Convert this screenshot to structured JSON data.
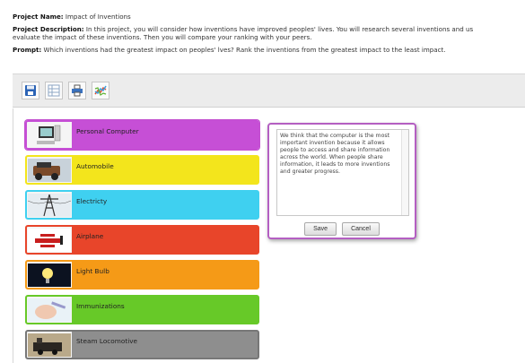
{
  "project": {
    "name_label": "Project Name:",
    "name_value": "Impact of Inventions",
    "description_label": "Project Description:",
    "description_line1": "In this project, you will consider how inventions have improved peoples' lives. You will research several inventions and us",
    "description_line2": "evaluate the impact of these inventions. Then you will compare your ranking with your peers.",
    "prompt_label": "Prompt:",
    "prompt_value": "Which inventions had the greatest impact on peoples' lves? Rank the inventions from the greatest impact to the least impact."
  },
  "toolbar": {
    "icons": [
      "save-icon",
      "table-icon",
      "print-icon",
      "chart-icon"
    ]
  },
  "inventions": [
    {
      "label": "Personal Computer",
      "color": "#c64fd6",
      "icon": "computer-icon"
    },
    {
      "label": "Automobile",
      "color": "#f3e51c",
      "icon": "car-icon"
    },
    {
      "label": "Electricty",
      "color": "#3fd0f0",
      "icon": "power-tower-icon"
    },
    {
      "label": "Airplane",
      "color": "#e8452a",
      "icon": "airplane-icon"
    },
    {
      "label": "Light Bulb",
      "color": "#f59a17",
      "icon": "light-bulb-icon"
    },
    {
      "label": "Immunizations",
      "color": "#67c928",
      "icon": "vaccine-icon"
    },
    {
      "label": "Steam Locomotive",
      "color": "#8e8e8e",
      "icon": "locomotive-icon"
    }
  ],
  "editor": {
    "text": "We think that the computer is the most important invention because it allows people to access and share information across the world. When people share information, it leads to more inventions and greater progress.",
    "save_label": "Save",
    "cancel_label": "Cancel"
  }
}
